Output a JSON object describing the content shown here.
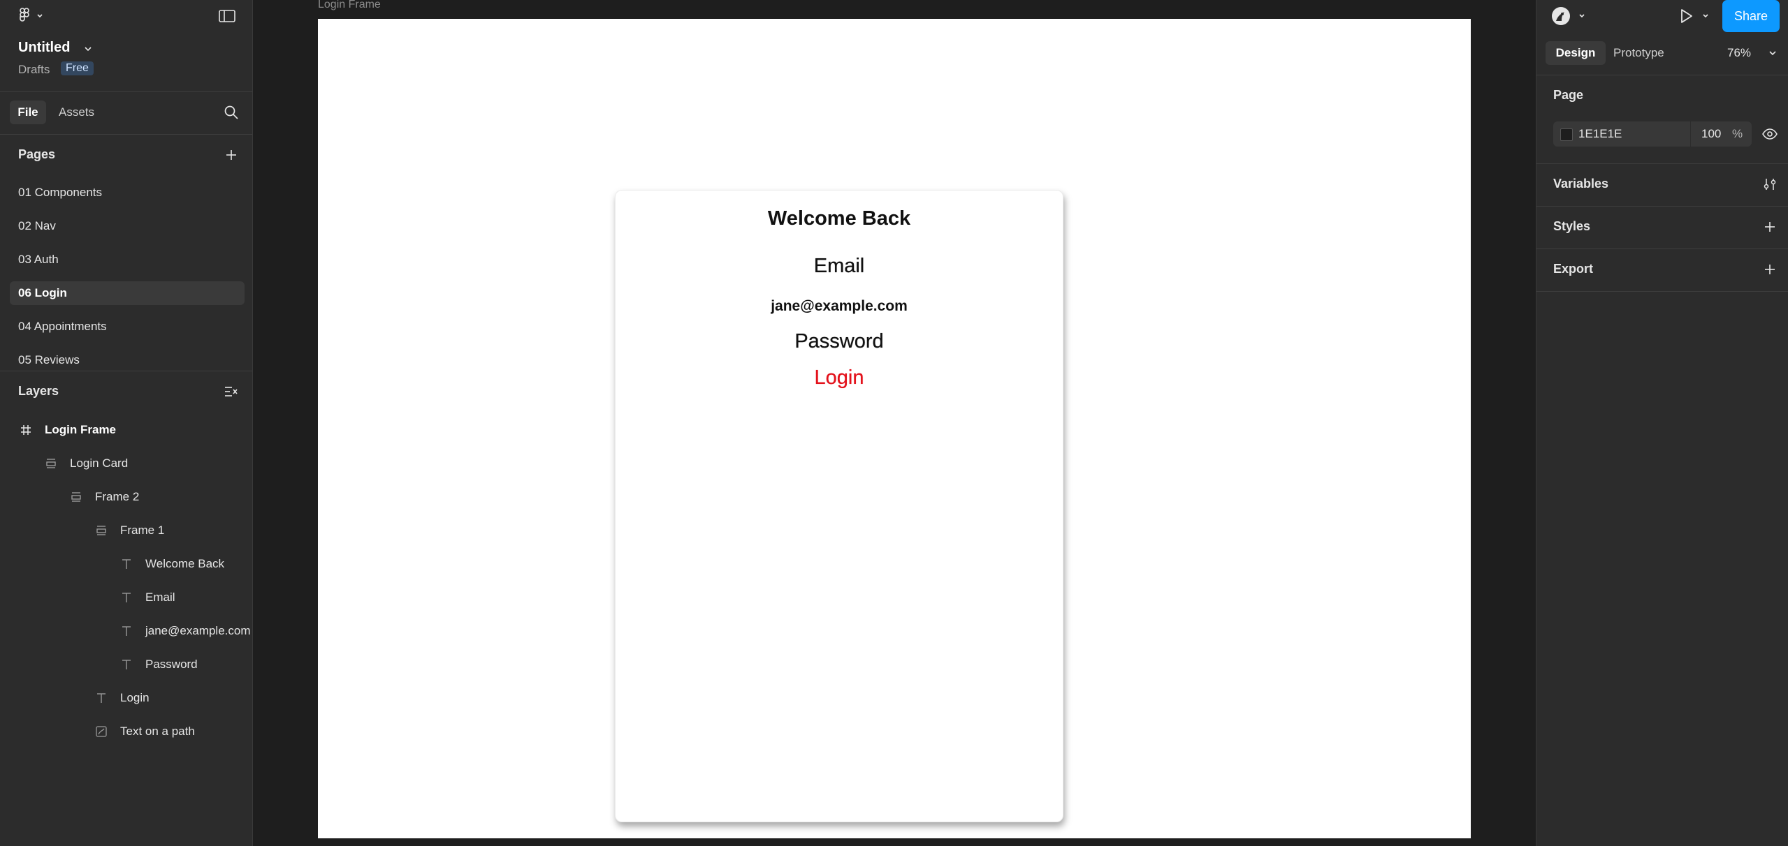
{
  "app": {
    "file_title": "Untitled",
    "location": "Drafts",
    "plan_badge": "Free"
  },
  "left_panel": {
    "tabs": [
      "File",
      "Assets"
    ],
    "pages_heading": "Pages",
    "pages": [
      "01 Components",
      "02 Nav",
      "03 Auth",
      "06 Login",
      "04 Appointments",
      "05 Reviews"
    ],
    "active_page": "06 Login",
    "layers_heading": "Layers",
    "layers": [
      {
        "label": "Login Frame",
        "type": "frame"
      },
      {
        "label": "Login Card",
        "type": "autolayout"
      },
      {
        "label": "Frame 2",
        "type": "autolayout"
      },
      {
        "label": "Frame 1",
        "type": "autolayout"
      },
      {
        "label": "Welcome Back",
        "type": "text"
      },
      {
        "label": "Email",
        "type": "text"
      },
      {
        "label": "jane@example.com",
        "type": "text"
      },
      {
        "label": "Password",
        "type": "text"
      },
      {
        "label": "Login",
        "type": "text"
      },
      {
        "label": "Text on a path",
        "type": "text-path"
      }
    ]
  },
  "canvas": {
    "frame_label": "Login Frame",
    "card": {
      "title": "Welcome Back",
      "email_label": "Email",
      "email_value": "jane@example.com",
      "password_label": "Password",
      "login_text": "Login"
    },
    "colors": {
      "login_text": "#e3111b",
      "card_bg": "#ffffff"
    }
  },
  "right_panel": {
    "share_label": "Share",
    "tabs": [
      "Design",
      "Prototype"
    ],
    "active_tab": "Design",
    "zoom": "76%",
    "page_heading": "Page",
    "page_color_hex": "1E1E1E",
    "page_opacity": "100",
    "page_opacity_unit": "%",
    "variables_heading": "Variables",
    "styles_heading": "Styles",
    "export_heading": "Export",
    "colors": {
      "accent": "#0d99ff",
      "page_swatch": "#1e1e1e"
    }
  }
}
